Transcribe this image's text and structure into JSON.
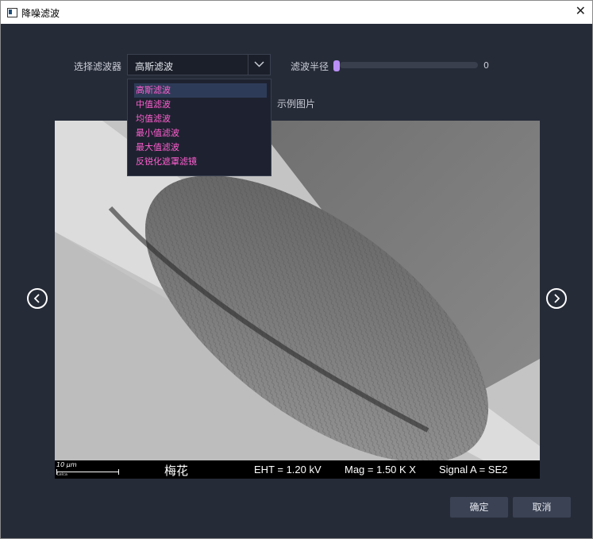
{
  "window": {
    "title": "降噪滤波",
    "close_symbol": "✕"
  },
  "filter": {
    "label": "选择滤波器",
    "selected": "高斯滤波",
    "options": [
      "高斯滤波",
      "中值滤波",
      "均值滤波",
      "最小值滤波",
      "最大值滤波",
      "反锐化遮罩滤镜"
    ]
  },
  "radius": {
    "label": "滤波半径",
    "value": "0"
  },
  "preview": {
    "caption": "示例图片",
    "image_description": "SEM micrograph of plum blossom pollen grain",
    "scale_label": "10 μm",
    "logo_text": "Leica",
    "sample_name": "梅花",
    "eht": "EHT =  1.20 kV",
    "mag": "Mag =   1.50 K X",
    "signal": "Signal A = SE2"
  },
  "nav": {
    "prev_icon": "chevron-left-icon",
    "next_icon": "chevron-right-icon"
  },
  "buttons": {
    "ok": "确定",
    "cancel": "取消"
  },
  "colors": {
    "background": "#262b38",
    "accent": "#b98ff5",
    "dropdown_text": "#ff5fd0"
  }
}
